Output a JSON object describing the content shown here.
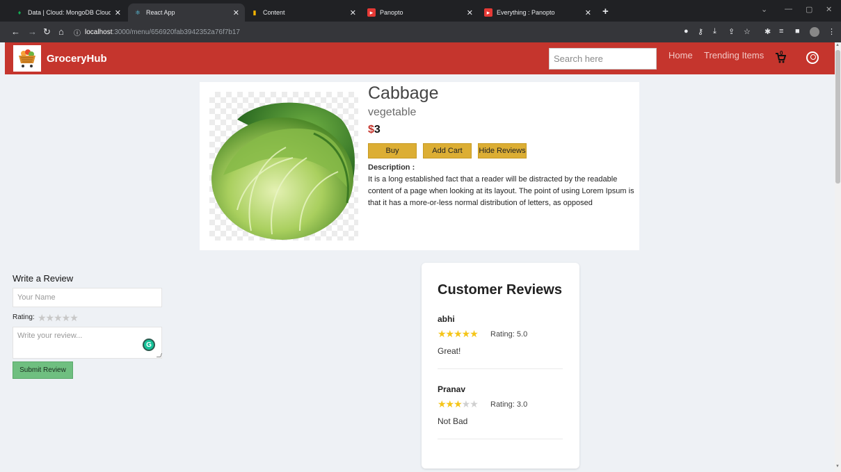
{
  "browser": {
    "tabs": [
      {
        "title": "Data | Cloud: MongoDB Cloud",
        "icon": "mongodb-leaf-icon",
        "color": "#13aa52"
      },
      {
        "title": "React App",
        "icon": "react-icon",
        "color": "#61dafb"
      },
      {
        "title": "Content",
        "icon": "bar-chart-icon",
        "color": "#f4b400"
      },
      {
        "title": "Panopto",
        "icon": "panopto-icon",
        "color": "#e53935"
      },
      {
        "title": "Everything : Panopto",
        "icon": "panopto-icon",
        "color": "#e53935"
      }
    ],
    "url_host": "localhost",
    "url_path": ":3000/menu/656920fab3942352a76f7b17"
  },
  "header": {
    "brand": "GroceryHub",
    "search_placeholder": "Search here",
    "nav": [
      "Home",
      "Trending Items"
    ],
    "cart_count": "0",
    "accent": "#c5352d"
  },
  "product": {
    "name": "Cabbage",
    "category": "vegetable",
    "currency": "$",
    "price": "3",
    "buttons": {
      "buy": "Buy",
      "add_cart": "Add Cart",
      "hide_reviews": "Hide Reviews"
    },
    "description_label": "Description :",
    "description": "It is a long established fact that a reader will be distracted by the readable content of a page when looking at its layout. The point of using Lorem Ipsum is that it has a more-or-less normal distribution of letters, as opposed"
  },
  "review_form": {
    "title": "Write a Review",
    "name_placeholder": "Your Name",
    "rating_label": "Rating:",
    "review_placeholder": "Write your review...",
    "submit": "Submit Review"
  },
  "reviews": {
    "title": "Customer Reviews",
    "items": [
      {
        "author": "abhi",
        "stars": 5,
        "score": "Rating: 5.0",
        "text": "Great!"
      },
      {
        "author": "Pranav",
        "stars": 3,
        "score": "Rating: 3.0",
        "text": "Not Bad"
      }
    ]
  }
}
